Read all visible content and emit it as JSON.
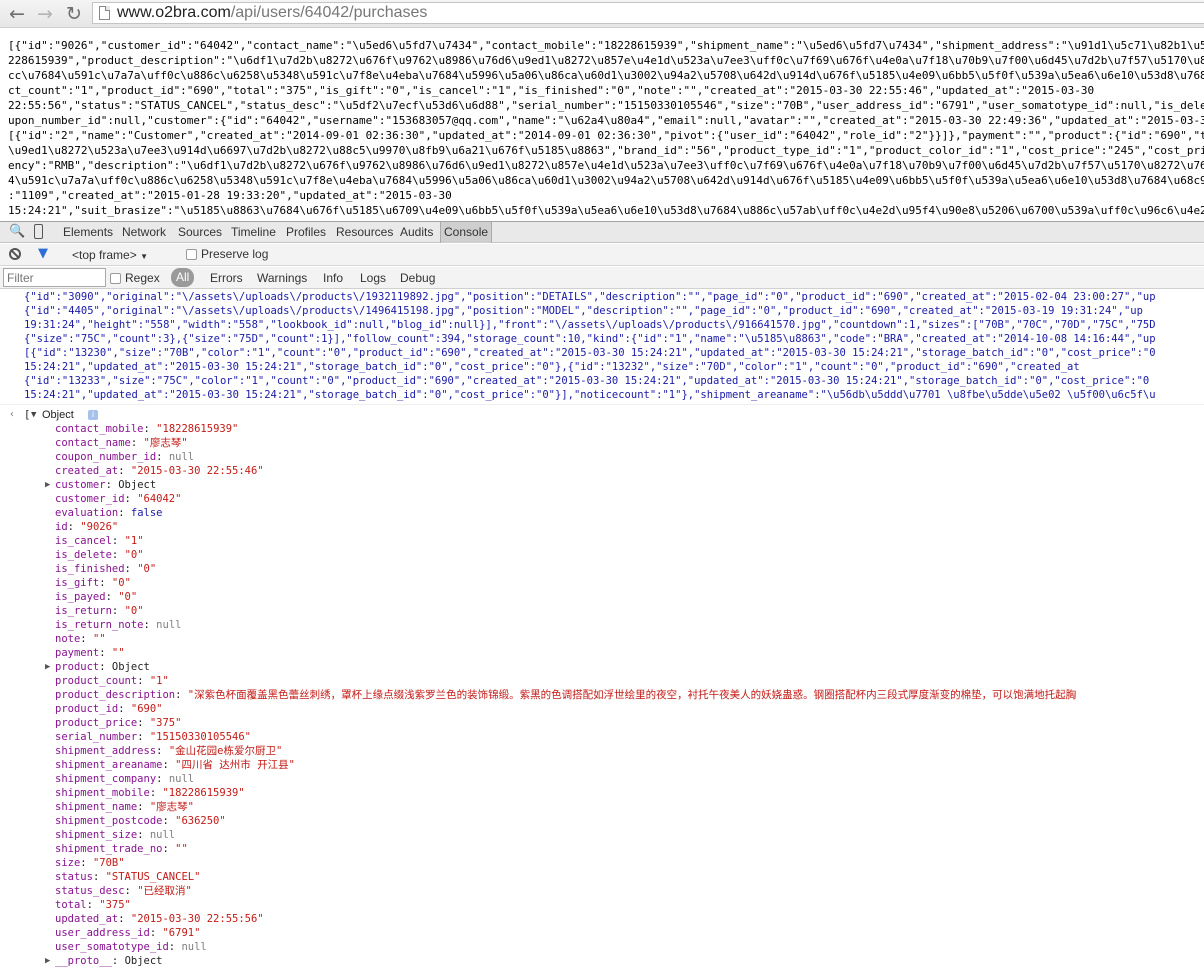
{
  "browser": {
    "url_host": "www.o2bra.com",
    "url_path": "/api/users/64042/purchases"
  },
  "raw_response": [
    "[{\"id\":\"9026\",\"customer_id\":\"64042\",\"contact_name\":\"\\u5ed6\\u5fd7\\u7434\",\"contact_mobile\":\"18228615939\",\"shipment_name\":\"\\u5ed6\\u5fd7\\u7434\",\"shipment_address\":\"\\u91d1\\u5c71\\u82b1\\u56ed",
    "228615939\",\"product_description\":\"\\u6df1\\u7d2b\\u8272\\u676f\\u9762\\u8986\\u76d6\\u9ed1\\u8272\\u857e\\u4e1d\\u523a\\u7ee3\\uff0c\\u7f69\\u676f\\u4e0a\\u7f18\\u70b9\\u7f00\\u6d45\\u7d2b\\u7f57\\u5170\\u8272",
    "cc\\u7684\\u591c\\u7a7a\\uff0c\\u886c\\u6258\\u5348\\u591c\\u7f8e\\u4eba\\u7684\\u5996\\u5a06\\u86ca\\u60d1\\u3002\\u94a2\\u5708\\u642d\\u914d\\u676f\\u5185\\u4e09\\u6bb5\\u5f0f\\u539a\\u5ea6\\u6e10\\u53d8\\u7684\\u",
    "ct_count\":\"1\",\"product_id\":\"690\",\"total\":\"375\",\"is_gift\":\"0\",\"is_cancel\":\"1\",\"is_finished\":\"0\",\"note\":\"\",\"created_at\":\"2015-03-30 22:55:46\",\"updated_at\":\"2015-03-30",
    "22:55:56\",\"status\":\"STATUS_CANCEL\",\"status_desc\":\"\\u5df2\\u7ecf\\u53d6\\u6d88\",\"serial_number\":\"15150330105546\",\"size\":\"70B\",\"user_address_id\":\"6791\",\"user_somatotype_id\":null,\"is_delete\"",
    "upon_number_id\":null,\"customer\":{\"id\":\"64042\",\"username\":\"153683057@qq.com\",\"name\":\"\\u62a4\\u80a4\",\"email\":null,\"avatar\":\"\",\"created_at\":\"2015-03-30 22:49:36\",\"updated_at\":\"2015-03-30 2",
    "[{\"id\":\"2\",\"name\":\"Customer\",\"created_at\":\"2014-09-01 02:36:30\",\"updated_at\":\"2014-09-01 02:36:30\",\"pivot\":{\"user_id\":\"64042\",\"role_id\":\"2\"}}]},\"payment\":\"\",\"product\":{\"id\":\"690\",\"titl",
    "\\u9ed1\\u8272\\u523a\\u7ee3\\u914d\\u6697\\u7d2b\\u8272\\u88c5\\u9970\\u8fb9\\u6a21\\u676f\\u5185\\u8863\",\"brand_id\":\"56\",\"product_type_id\":\"1\",\"product_color_id\":\"1\",\"cost_price\":\"245\",\"cost_price_",
    "ency\":\"RMB\",\"description\":\"\\u6df1\\u7d2b\\u8272\\u676f\\u9762\\u8986\\u76d6\\u9ed1\\u8272\\u857e\\u4e1d\\u523a\\u7ee3\\uff0c\\u7f69\\u676f\\u4e0a\\u7f18\\u70b9\\u7f00\\u6d45\\u7d2b\\u7f57\\u5170\\u8272\\u7684\\",
    "4\\u591c\\u7a7a\\uff0c\\u886c\\u6258\\u5348\\u591c\\u7f8e\\u4eba\\u7684\\u5996\\u5a06\\u86ca\\u60d1\\u3002\\u94a2\\u5708\\u642d\\u914d\\u676f\\u5185\\u4e09\\u6bb5\\u5f0f\\u539a\\u5ea6\\u6e10\\u53d8\\u7684\\u68c9\\u5",
    ":\"1109\",\"created_at\":\"2015-01-28 19:33:20\",\"updated_at\":\"2015-03-30",
    "15:24:21\",\"suit_brasize\":\"\\u5185\\u8863\\u7684\\u676f\\u5185\\u6709\\u4e09\\u6bb5\\u5f0f\\u539a\\u5ea6\\u6e10\\u53d8\\u7684\\u886c\\u57ab\\uff0c\\u4e2d\\u95f4\\u90e8\\u5206\\u6700\\u539a\\uff0c\\u96c6\\u4e2d\\u"
  ],
  "devtools": {
    "tabs": [
      "Elements",
      "Network",
      "Sources",
      "Timeline",
      "Profiles",
      "Resources",
      "Audits",
      "Console"
    ],
    "selected_tab": "Console",
    "frame_label": "<top frame>",
    "preserve_log_label": "Preserve log",
    "filter_placeholder": "Filter",
    "regex_label": "Regex",
    "levels": [
      "All",
      "Errors",
      "Warnings",
      "Info",
      "Logs",
      "Debug"
    ],
    "selected_level": "All"
  },
  "console": {
    "truncated_output": [
      "{\"id\":\"3090\",\"original\":\"\\/assets\\/uploads\\/products\\/1932119892.jpg\",\"position\":\"DETAILS\",\"description\":\"\",\"page_id\":\"0\",\"product_id\":\"690\",\"created_at\":\"2015-02-04 23:00:27\",\"up",
      "{\"id\":\"4405\",\"original\":\"\\/assets\\/uploads\\/products\\/1496415198.jpg\",\"position\":\"MODEL\",\"description\":\"\",\"page_id\":\"0\",\"product_id\":\"690\",\"created_at\":\"2015-03-19 19:31:24\",\"up",
      "19:31:24\",\"height\":\"558\",\"width\":\"558\",\"lookbook_id\":null,\"blog_id\":null}],\"front\":\"\\/assets\\/uploads\\/products\\/916641570.jpg\",\"countdown\":1,\"sizes\":[\"70B\",\"70C\",\"70D\",\"75C\",\"75D",
      "{\"size\":\"75C\",\"count\":3},{\"size\":\"75D\",\"count\":1}],\"follow_count\":394,\"storage_count\":10,\"kind\":{\"id\":\"1\",\"name\":\"\\u5185\\u8863\",\"code\":\"BRA\",\"created_at\":\"2014-10-08 14:16:44\",\"up",
      "[{\"id\":\"13230\",\"size\":\"70B\",\"color\":\"1\",\"count\":\"0\",\"product_id\":\"690\",\"created_at\":\"2015-03-30 15:24:21\",\"updated_at\":\"2015-03-30 15:24:21\",\"storage_batch_id\":\"0\",\"cost_price\":\"0",
      "15:24:21\",\"updated_at\":\"2015-03-30 15:24:21\",\"storage_batch_id\":\"0\",\"cost_price\":\"0\"},{\"id\":\"13232\",\"size\":\"70D\",\"color\":\"1\",\"count\":\"0\",\"product_id\":\"690\",\"created_at",
      "{\"id\":\"13233\",\"size\":\"75C\",\"color\":\"1\",\"count\":\"0\",\"product_id\":\"690\",\"created_at\":\"2015-03-30 15:24:21\",\"updated_at\":\"2015-03-30 15:24:21\",\"storage_batch_id\":\"0\",\"cost_price\":\"0",
      "15:24:21\",\"updated_at\":\"2015-03-30 15:24:21\",\"storage_batch_id\":\"0\",\"cost_price\":\"0\"}],\"noticecount\":\"1\"},\"shipment_areaname\":\"\\u56db\\u5ddd\\u7701 \\u8fbe\\u5dde\\u5e02 \\u5f00\\u6c5f\\u"
    ],
    "object_bracket": "[",
    "object_label": "Object",
    "info_badge": "i",
    "properties": [
      {
        "key": "contact_mobile",
        "value": "\"18228615939\"",
        "type": "str"
      },
      {
        "key": "contact_name",
        "value": "\"廖志琴\"",
        "type": "str"
      },
      {
        "key": "coupon_number_id",
        "value": "null",
        "type": "null"
      },
      {
        "key": "created_at",
        "value": "\"2015-03-30 22:55:46\"",
        "type": "str"
      },
      {
        "key": "customer",
        "value": "Object",
        "type": "obj",
        "expandable": true
      },
      {
        "key": "customer_id",
        "value": "\"64042\"",
        "type": "str"
      },
      {
        "key": "evaluation",
        "value": "false",
        "type": "bool"
      },
      {
        "key": "id",
        "value": "\"9026\"",
        "type": "str"
      },
      {
        "key": "is_cancel",
        "value": "\"1\"",
        "type": "str"
      },
      {
        "key": "is_delete",
        "value": "\"0\"",
        "type": "str"
      },
      {
        "key": "is_finished",
        "value": "\"0\"",
        "type": "str"
      },
      {
        "key": "is_gift",
        "value": "\"0\"",
        "type": "str"
      },
      {
        "key": "is_payed",
        "value": "\"0\"",
        "type": "str"
      },
      {
        "key": "is_return",
        "value": "\"0\"",
        "type": "str"
      },
      {
        "key": "is_return_note",
        "value": "null",
        "type": "null"
      },
      {
        "key": "note",
        "value": "\"\"",
        "type": "str"
      },
      {
        "key": "payment",
        "value": "\"\"",
        "type": "str"
      },
      {
        "key": "product",
        "value": "Object",
        "type": "obj",
        "expandable": true
      },
      {
        "key": "product_count",
        "value": "\"1\"",
        "type": "str"
      },
      {
        "key": "product_description",
        "value": "\"深紫色杯面覆盖黑色蕾丝刺绣，罩杯上缘点缀浅紫罗兰色的装饰锦缎。紫黑的色调搭配如浮世绘里的夜空，衬托午夜美人的妖娆蛊惑。钢圈搭配杯内三段式厚度渐变的棉垫，可以饱满地托起胸",
        "type": "str"
      },
      {
        "key": "product_id",
        "value": "\"690\"",
        "type": "str"
      },
      {
        "key": "product_price",
        "value": "\"375\"",
        "type": "str"
      },
      {
        "key": "serial_number",
        "value": "\"15150330105546\"",
        "type": "str"
      },
      {
        "key": "shipment_address",
        "value": "\"金山花园e栋爱尔厨卫\"",
        "type": "str"
      },
      {
        "key": "shipment_areaname",
        "value": "\"四川省 达州市 开江县\"",
        "type": "str"
      },
      {
        "key": "shipment_company",
        "value": "null",
        "type": "null"
      },
      {
        "key": "shipment_mobile",
        "value": "\"18228615939\"",
        "type": "str"
      },
      {
        "key": "shipment_name",
        "value": "\"廖志琴\"",
        "type": "str"
      },
      {
        "key": "shipment_postcode",
        "value": "\"636250\"",
        "type": "str"
      },
      {
        "key": "shipment_size",
        "value": "null",
        "type": "null"
      },
      {
        "key": "shipment_trade_no",
        "value": "\"\"",
        "type": "str"
      },
      {
        "key": "size",
        "value": "\"70B\"",
        "type": "str"
      },
      {
        "key": "status",
        "value": "\"STATUS_CANCEL\"",
        "type": "str"
      },
      {
        "key": "status_desc",
        "value": "\"已经取消\"",
        "type": "str"
      },
      {
        "key": "total",
        "value": "\"375\"",
        "type": "str"
      },
      {
        "key": "updated_at",
        "value": "\"2015-03-30 22:55:56\"",
        "type": "str"
      },
      {
        "key": "user_address_id",
        "value": "\"6791\"",
        "type": "str"
      },
      {
        "key": "user_somatotype_id",
        "value": "null",
        "type": "null"
      },
      {
        "key": "__proto__",
        "value": "Object",
        "type": "obj",
        "expandable": true
      }
    ]
  }
}
